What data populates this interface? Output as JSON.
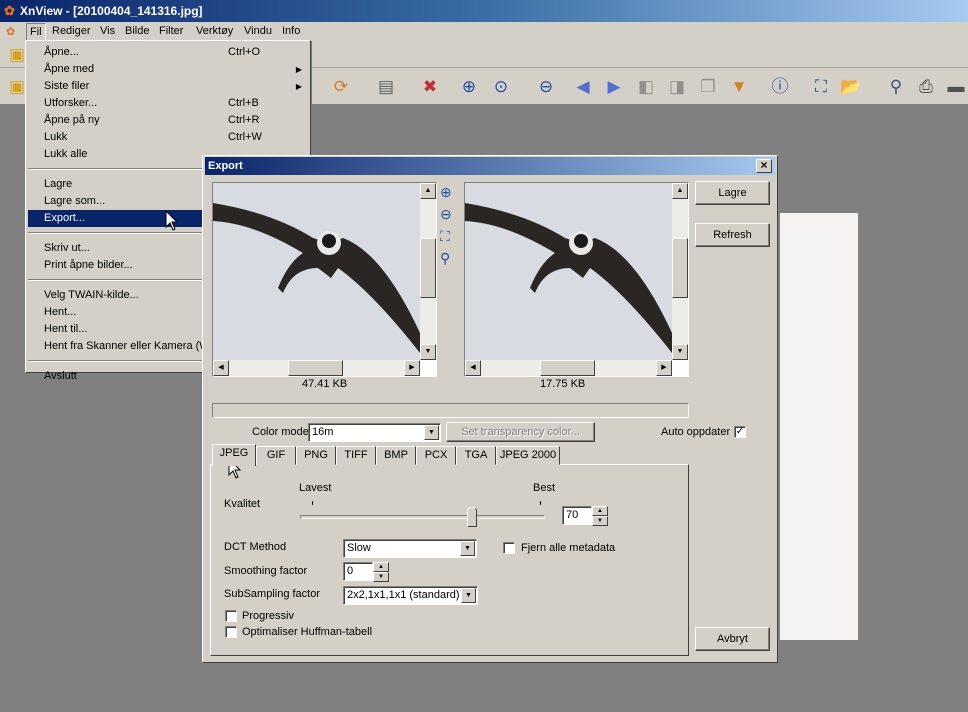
{
  "window": {
    "title": "XnView - [20100404_141316.jpg]"
  },
  "menubar": [
    "Fil",
    "Rediger",
    "Vis",
    "Bilde",
    "Filter",
    "Verktøy",
    "Vindu",
    "Info"
  ],
  "file_menu": [
    {
      "label": "Åpne...",
      "shortcut": "Ctrl+O"
    },
    {
      "label": "Åpne med",
      "submenu": true
    },
    {
      "label": "Siste filer",
      "submenu": true
    },
    {
      "label": "Utforsker...",
      "shortcut": "Ctrl+B"
    },
    {
      "label": "Åpne på ny",
      "shortcut": "Ctrl+R"
    },
    {
      "label": "Lukk",
      "shortcut": "Ctrl+W"
    },
    {
      "label": "Lukk alle"
    },
    {
      "label": "Lagre"
    },
    {
      "label": "Lagre som..."
    },
    {
      "label": "Export...",
      "selected": true
    },
    {
      "label": "Skriv ut..."
    },
    {
      "label": "Print åpne bilder..."
    },
    {
      "label": "Velg TWAIN-kilde..."
    },
    {
      "label": "Hent..."
    },
    {
      "label": "Hent til..."
    },
    {
      "label": "Hent fra Skanner eller Kamera (W"
    },
    {
      "label": "Avslutt"
    }
  ],
  "dialog": {
    "title": "Export",
    "close": "×",
    "original_size": "47.41 KB",
    "preview_size": "17.75 KB",
    "save_button": "Lagre",
    "refresh_button": "Refresh",
    "cancel_button": "Avbryt",
    "color_mode_label": "Color mode",
    "color_mode_value": "16m",
    "transparency_button": "Set transparency color...",
    "auto_update_label": "Auto oppdater",
    "auto_update_checked": true,
    "tabs": [
      "JPEG",
      "GIF",
      "PNG",
      "TIFF",
      "BMP",
      "PCX",
      "TGA",
      "JPEG 2000"
    ],
    "active_tab": "JPEG",
    "jpeg": {
      "quality_label": "Kvalitet",
      "quality_min_label": "Lavest",
      "quality_max_label": "Best",
      "quality_value": "70",
      "dct_label": "DCT Method",
      "dct_value": "Slow",
      "remove_metadata_label": "Fjern alle metadata",
      "remove_metadata_checked": false,
      "smoothing_label": "Smoothing factor",
      "smoothing_value": "0",
      "subsampling_label": "SubSampling factor",
      "subsampling_value": "2x2,1x1,1x1 (standard)",
      "progressive_label": "Progressiv",
      "huffman_label": "Optimaliser Huffman-tabell"
    }
  },
  "colors": {
    "titlebar": "#0a246a",
    "selection": "#0a246a",
    "face": "#d4d0c8",
    "workspace": "#808080"
  }
}
